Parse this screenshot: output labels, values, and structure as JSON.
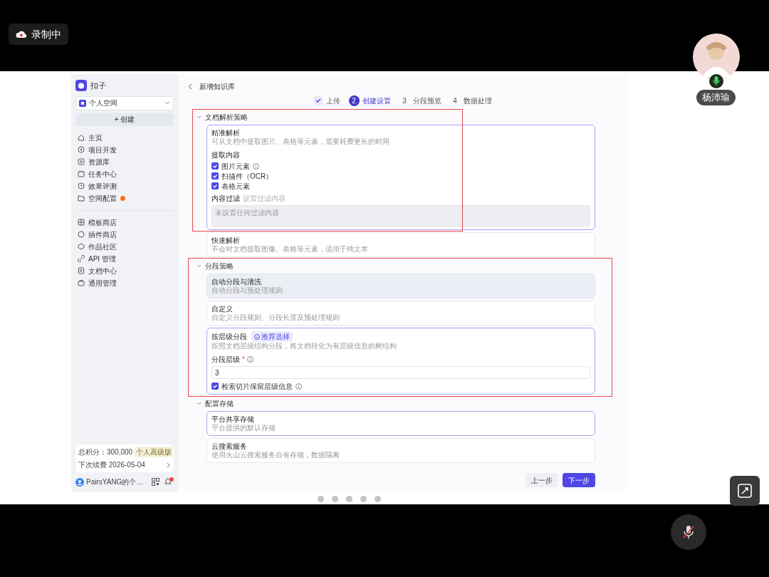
{
  "recording": {
    "label": "录制中"
  },
  "participant": {
    "name": "杨沛瑜",
    "mic_on": true
  },
  "shared_screen": {
    "sidebar": {
      "brand": "扣子",
      "space": "个人空间",
      "create_button": "+ 创建",
      "nav_primary": [
        {
          "label": "主页",
          "badge": false
        },
        {
          "label": "项目开发",
          "badge": false
        },
        {
          "label": "资源库",
          "badge": false
        },
        {
          "label": "任务中心",
          "badge": false
        },
        {
          "label": "效果评测",
          "badge": false
        },
        {
          "label": "空间配置",
          "badge": true
        }
      ],
      "nav_secondary": [
        {
          "label": "模板商店"
        },
        {
          "label": "插件商店"
        },
        {
          "label": "作品社区"
        },
        {
          "label": "API 管理"
        },
        {
          "label": "文档中心"
        },
        {
          "label": "通用管理"
        }
      ],
      "points": "总积分：300,000",
      "plan_tag": "个人高级版",
      "renewal": "下次续费 2026-05-04",
      "user": "PairsYANG的个…",
      "notifications": true
    },
    "page": {
      "title": "新增知识库",
      "steps": [
        {
          "label": "上传",
          "done": true,
          "current": false
        },
        {
          "number": "2",
          "label": "创建设置",
          "done": false,
          "current": true
        },
        {
          "number": "3",
          "label": "分段预览",
          "done": false,
          "current": false
        },
        {
          "number": "4",
          "label": "数据处理",
          "done": false,
          "current": false
        }
      ],
      "parse_strategy": {
        "heading": "文档解析策略",
        "highlighted": true,
        "options": [
          {
            "kind": "detailed",
            "title": "精准解析",
            "description": "可从文档中提取图片、表格等元素，需要耗费更长的时间",
            "selected": true,
            "extract_label": "提取内容",
            "extract": [
              {
                "label": "图片元素",
                "checked": true,
                "info": true
              },
              {
                "label": "扫描件（OCR）",
                "checked": true
              },
              {
                "label": "表格元素",
                "checked": true
              }
            ],
            "filter_label": "内容过滤",
            "filter_hint": "设置过滤内容",
            "filter_placeholder": "未设置任何过滤内容"
          },
          {
            "title": "快速解析",
            "description": "不会对文档提取图像、表格等元素，适用于纯文本",
            "selected": false
          }
        ]
      },
      "segment_strategy": {
        "heading": "分段策略",
        "highlighted": true,
        "options": [
          {
            "title": "自动分段与清洗",
            "description": "自动分段与预处理规则",
            "selected": false,
            "disabled": true
          },
          {
            "title": "自定义",
            "description": "自定义分段规则、分段长度及预处理规则",
            "selected": false,
            "disabled": false
          },
          {
            "kind": "hierarchy",
            "title": "按层级分段",
            "tag": "推荐选择",
            "description": "按照文档层级结构分段，将文档转化为有层级信息的树结构",
            "selected": true,
            "disabled": false,
            "level_label": "分段层级",
            "required_mark": "*",
            "level_value": "3",
            "keep_label": "检索切片保留层级信息",
            "keep_checked": true
          }
        ]
      },
      "storage": {
        "heading": "配置存储",
        "options": [
          {
            "title": "平台共享存储",
            "description": "平台提供的默认存储",
            "selected": true
          },
          {
            "title": "云搜索服务",
            "description": "使用火山云搜索服务自有存储，数据隔离",
            "selected": false
          }
        ]
      },
      "prev_button": "上一步",
      "next_button": "下一步"
    }
  },
  "pager": [
    {
      "selected": false
    },
    {
      "selected": false
    },
    {
      "selected": false
    },
    {
      "selected": false
    },
    {
      "selected": false
    }
  ],
  "mic_button": {
    "muted": true
  }
}
